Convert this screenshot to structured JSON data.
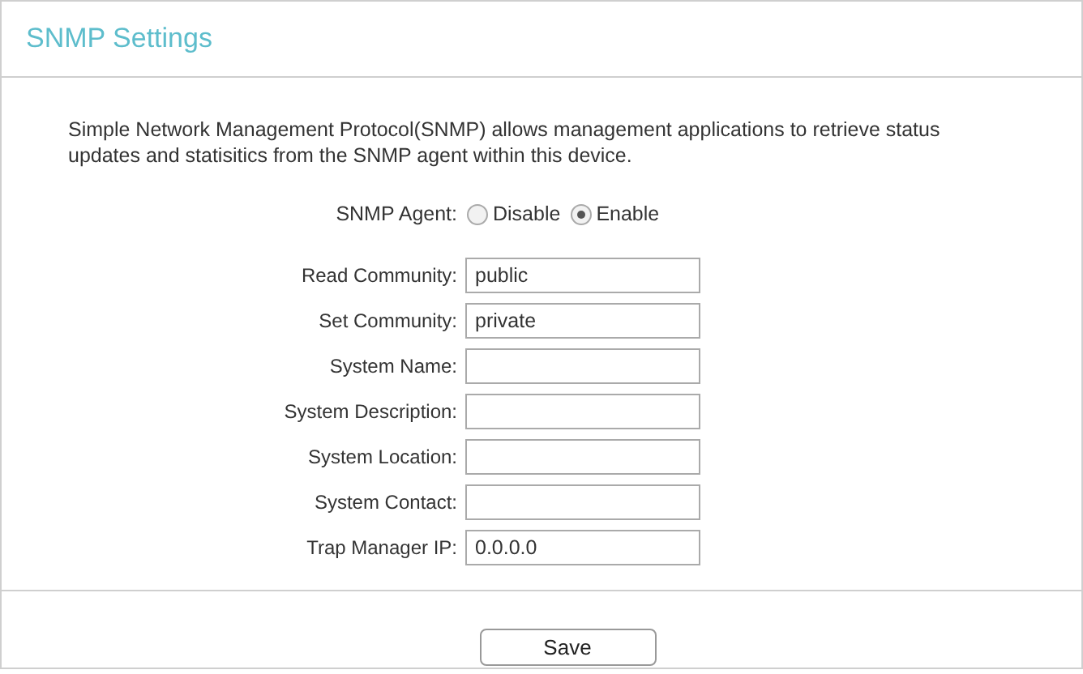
{
  "title": "SNMP Settings",
  "description": "Simple Network Management Protocol(SNMP) allows management applications to retrieve status updates and statisitics from the SNMP agent within this device.",
  "snmp_agent": {
    "label": "SNMP Agent:",
    "options": [
      {
        "label": "Disable",
        "selected": false
      },
      {
        "label": "Enable",
        "selected": true
      }
    ]
  },
  "fields": [
    {
      "label": "Read Community:",
      "value": "public"
    },
    {
      "label": "Set Community:",
      "value": "private"
    },
    {
      "label": "System Name:"
    },
    {
      "label": "System Description:"
    },
    {
      "label": "System Location:"
    },
    {
      "label": "System Contact:"
    },
    {
      "label": "Trap Manager IP:",
      "value": "0.0.0.0"
    }
  ],
  "save_button": "Save"
}
